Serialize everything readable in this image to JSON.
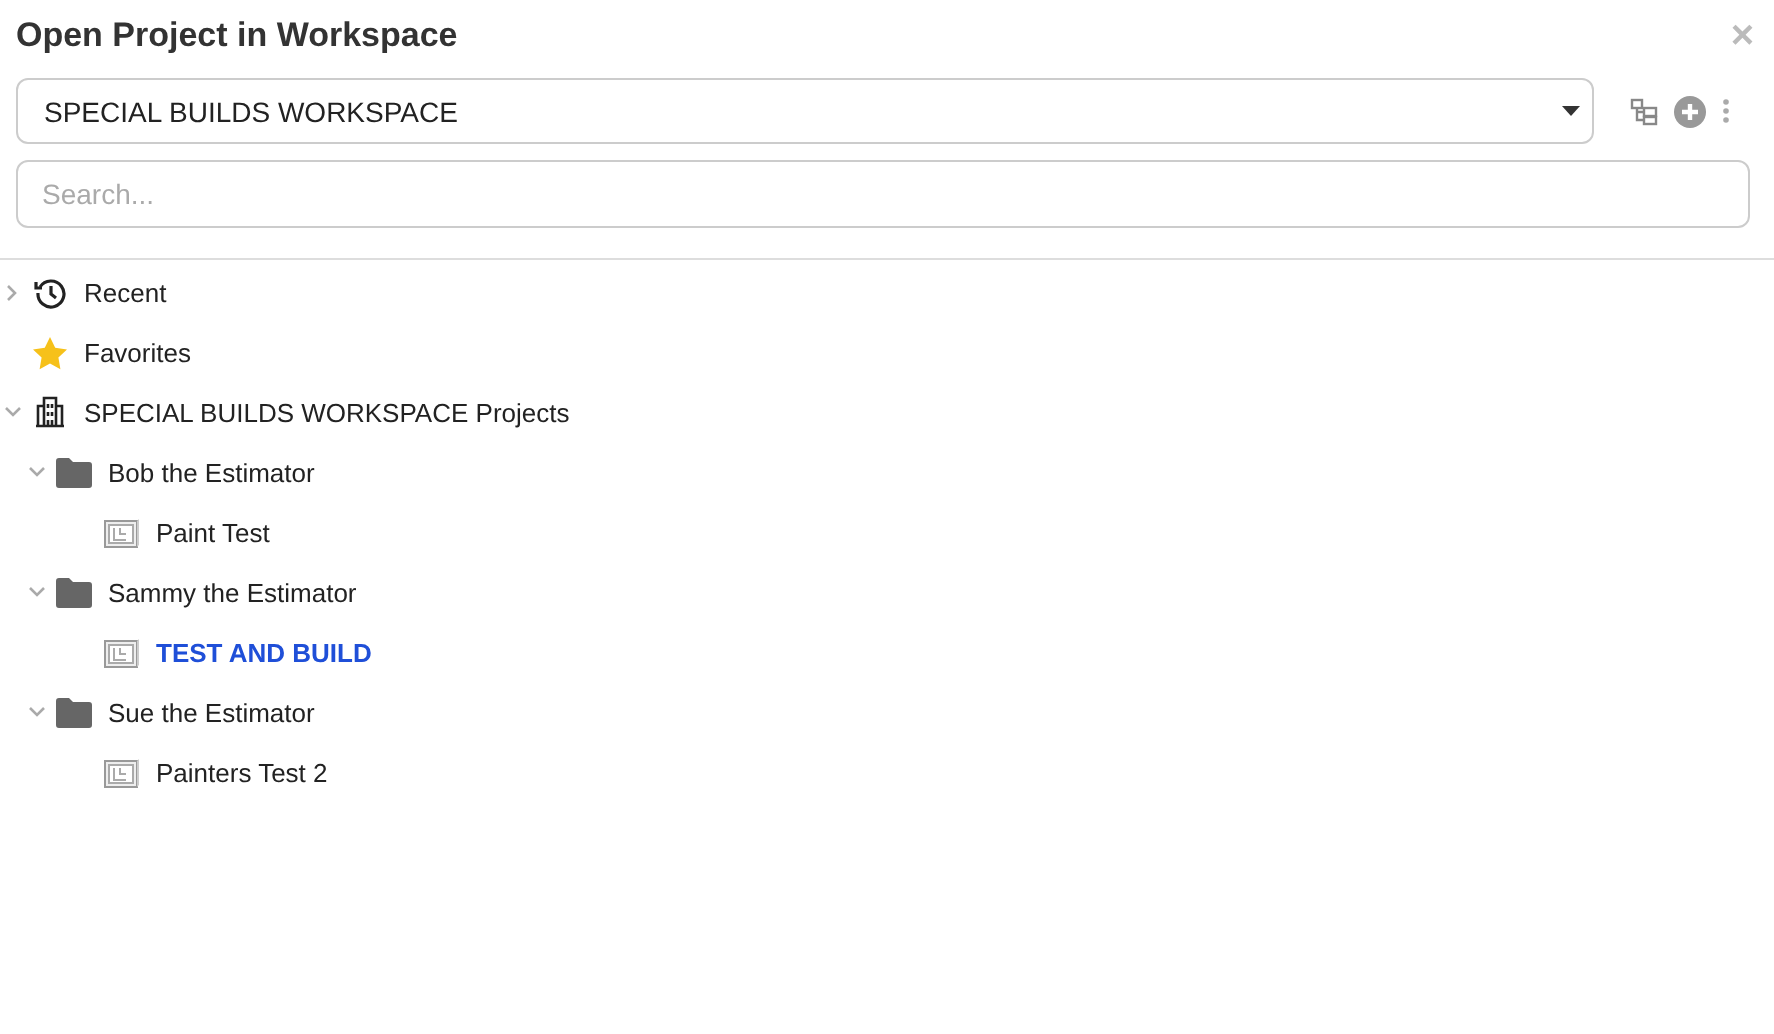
{
  "window": {
    "title": "Open Project in Workspace",
    "close": "×"
  },
  "workspace_select": {
    "value": "SPECIAL BUILDS WORKSPACE"
  },
  "search": {
    "placeholder": "Search..."
  },
  "tree": [
    {
      "kind": "recent",
      "label": "Recent",
      "expanded": false
    },
    {
      "kind": "favorites",
      "label": "Favorites"
    },
    {
      "kind": "workspace",
      "label": "SPECIAL BUILDS WORKSPACE Projects",
      "expanded": true,
      "children": [
        {
          "kind": "folder",
          "label": "Bob the Estimator",
          "expanded": true,
          "children": [
            {
              "kind": "project",
              "label": "Paint Test",
              "selected": false
            }
          ]
        },
        {
          "kind": "folder",
          "label": "Sammy the Estimator",
          "expanded": true,
          "children": [
            {
              "kind": "project",
              "label": "TEST AND BUILD",
              "selected": true
            }
          ]
        },
        {
          "kind": "folder",
          "label": "Sue the Estimator",
          "expanded": true,
          "children": [
            {
              "kind": "project",
              "label": "Painters Test 2",
              "selected": false
            }
          ]
        }
      ]
    }
  ]
}
